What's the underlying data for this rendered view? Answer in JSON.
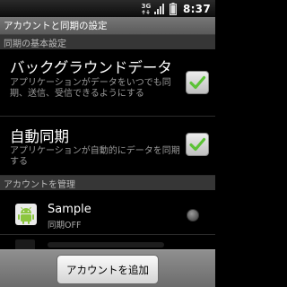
{
  "status_bar": {
    "network": "3G",
    "signal_icon": "signal-bars-icon",
    "battery_icon": "battery-icon",
    "time": "8:37"
  },
  "title": "アカウントと同期の設定",
  "general_section": {
    "header": "同期の基本設定",
    "items": [
      {
        "title": "バックグラウンドデータ",
        "summary": "アプリケーションがデータをいつでも同期、送信、受信できるようにする",
        "checked": true
      },
      {
        "title": "自動同期",
        "summary": "アプリケーションが自動的にデータを同期する",
        "checked": true
      }
    ]
  },
  "accounts_section": {
    "header": "アカウントを管理",
    "accounts": [
      {
        "name": "Sample",
        "status": "同期OFF",
        "icon": "android-robot-icon"
      }
    ]
  },
  "footer": {
    "add_account_label": "アカウントを追加"
  },
  "colors": {
    "check_green": "#5bc236",
    "section_header_bg": "#363636",
    "title_bar_bg": "#6a6a6a"
  }
}
